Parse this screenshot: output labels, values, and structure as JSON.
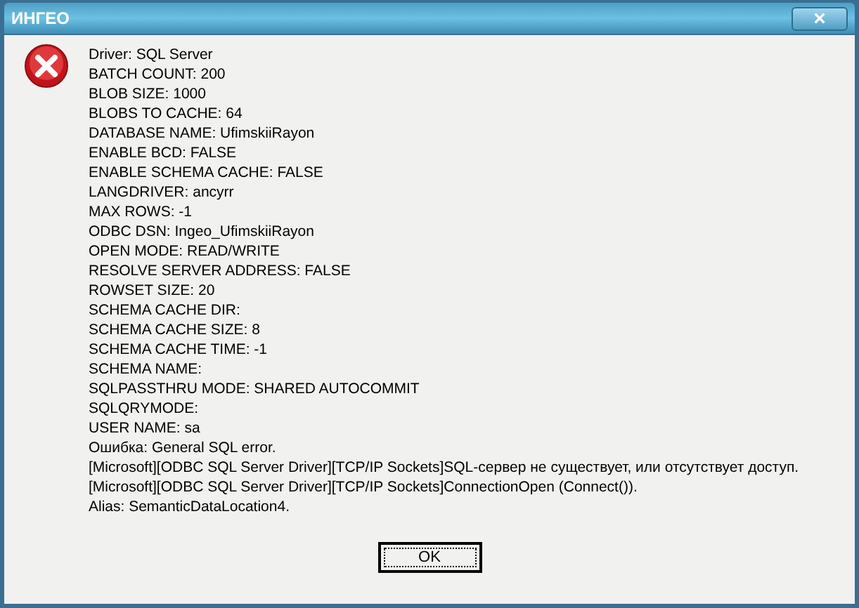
{
  "window": {
    "title": "ИНГЕО",
    "close": "×"
  },
  "message_lines": [
    "Driver: SQL Server",
    "BATCH COUNT: 200",
    "BLOB SIZE: 1000",
    "BLOBS TO CACHE: 64",
    "DATABASE NAME: UfimskiiRayon",
    "ENABLE BCD: FALSE",
    "ENABLE SCHEMA CACHE: FALSE",
    "LANGDRIVER: ancyrr",
    "MAX ROWS: -1",
    "ODBC DSN: Ingeo_UfimskiiRayon",
    "OPEN MODE: READ/WRITE",
    "RESOLVE SERVER ADDRESS: FALSE",
    "ROWSET SIZE: 20",
    "SCHEMA CACHE DIR:",
    "SCHEMA CACHE SIZE: 8",
    "SCHEMA CACHE TIME: -1",
    "SCHEMA NAME:",
    "SQLPASSTHRU MODE: SHARED AUTOCOMMIT",
    "SQLQRYMODE:",
    "USER NAME: sa",
    "Ошибка: General SQL error.",
    "[Microsoft][ODBC SQL Server Driver][TCP/IP Sockets]SQL-сервер не существует, или отсутствует доступ.",
    "[Microsoft][ODBC SQL Server Driver][TCP/IP Sockets]ConnectionOpen (Connect()).",
    "Alias: SemanticDataLocation4."
  ],
  "buttons": [
    {
      "label": "OK",
      "focused": true
    }
  ]
}
